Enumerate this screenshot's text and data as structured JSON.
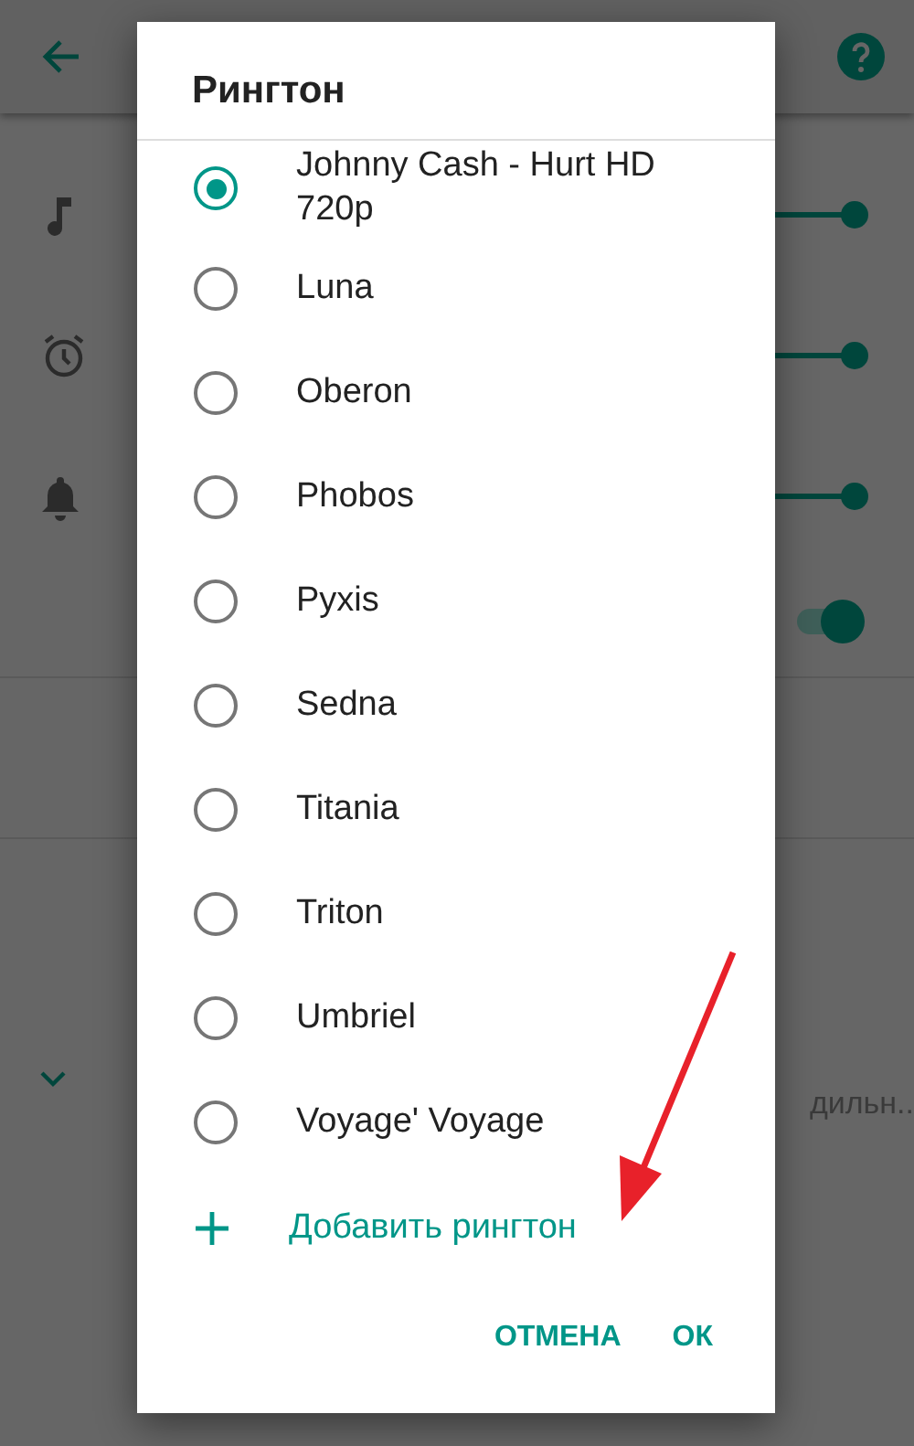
{
  "background": {
    "sliders": [
      {
        "kind": "music",
        "level": 1
      },
      {
        "kind": "alarm",
        "level": 1
      },
      {
        "kind": "bell",
        "level": 1
      }
    ],
    "toggle": {
      "on": true
    },
    "truncated_text": "дильн.."
  },
  "dialog": {
    "title": "Рингтон",
    "ringtones": [
      {
        "label": "Johnny Cash - Hurt HD 720p",
        "selected": true
      },
      {
        "label": "Luna",
        "selected": false
      },
      {
        "label": "Oberon",
        "selected": false
      },
      {
        "label": "Phobos",
        "selected": false
      },
      {
        "label": "Pyxis",
        "selected": false
      },
      {
        "label": "Sedna",
        "selected": false
      },
      {
        "label": "Titania",
        "selected": false
      },
      {
        "label": "Triton",
        "selected": false
      },
      {
        "label": "Umbriel",
        "selected": false
      },
      {
        "label": "Voyage' Voyage",
        "selected": false
      }
    ],
    "add_action": "Добавить рингтон",
    "buttons": [
      "ОТМЕНА",
      "ОК"
    ]
  }
}
